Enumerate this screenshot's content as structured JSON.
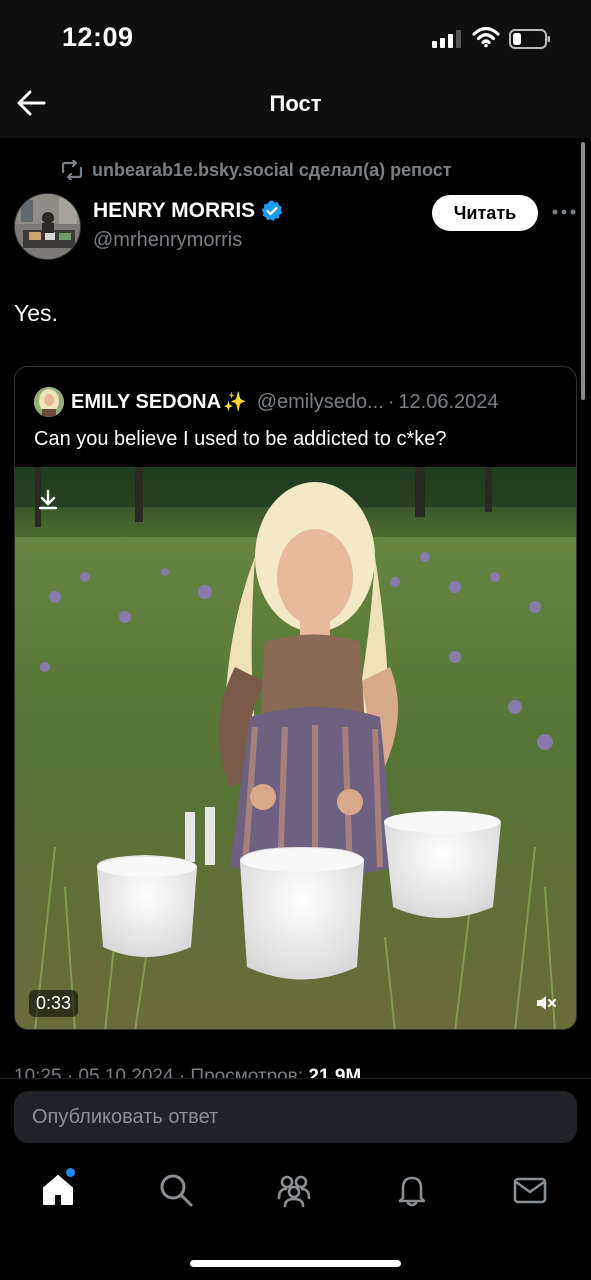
{
  "status_bar": {
    "time": "12:09"
  },
  "nav": {
    "title": "Пост"
  },
  "repost": {
    "text": "unbearab1e.bsky.social сделал(а) репост"
  },
  "author": {
    "name": "HENRY MORRIS",
    "handle": "@mrhenrymorris",
    "follow_label": "Читать"
  },
  "post": {
    "text": "Yes."
  },
  "quote": {
    "name": "EMILY SEDONA",
    "emoji": "✨",
    "handle": "@emilysedo...",
    "separator": "·",
    "date": "12.06.2024",
    "text": "Can you believe I used to be addicted to c*ke?",
    "video": {
      "duration": "0:33"
    }
  },
  "meta": {
    "partial_text": "10:25 · 05.10.2024 · Просмотров:",
    "views": "21,9M"
  },
  "reply": {
    "placeholder": "Опубликовать ответ"
  },
  "tabs": [
    "home-icon",
    "search-icon",
    "community-icon",
    "bell-icon",
    "mail-icon"
  ],
  "colors": {
    "accent": "#1d9bf0",
    "muted": "#7a7f85",
    "background": "#000000"
  }
}
